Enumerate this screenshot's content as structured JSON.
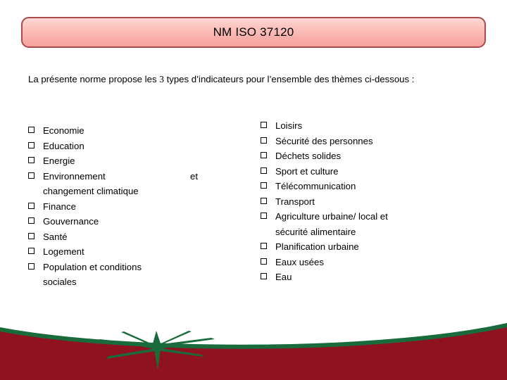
{
  "title": {
    "text": "NM ISO 37120"
  },
  "intro": {
    "part1": "La présente norme propose les ",
    "count": "3",
    "part2": " types d’indicateurs pour l’ensemble des thèmes ci-dessous :"
  },
  "bullet_symbol": "q",
  "columns": {
    "left": [
      {
        "label": "Economie"
      },
      {
        "label": "Education"
      },
      {
        "label": "Energie"
      },
      {
        "label": "Environnement",
        "trailing": "et",
        "continuation": "changement climatique"
      },
      {
        "label": "Finance"
      },
      {
        "label": "Gouvernance"
      },
      {
        "label": "Santé"
      },
      {
        "label": "Logement"
      },
      {
        "label": "Population et conditions",
        "continuation": "sociales"
      }
    ],
    "right": [
      {
        "label": "Loisirs"
      },
      {
        "label": "Sécurité des personnes"
      },
      {
        "label": "Déchets solides"
      },
      {
        "label": "Sport et culture"
      },
      {
        "label": "Télécommunication"
      },
      {
        "label": "Transport"
      },
      {
        "label": "Agriculture urbaine/ local et",
        "continuation": "sécurité alimentaire"
      },
      {
        "label": "Planification urbaine"
      },
      {
        "label": "Eaux usées"
      },
      {
        "label": "Eau"
      }
    ]
  },
  "colors": {
    "banner_border": "#a84a4a",
    "banner_fill_top": "#fdd8d4",
    "banner_fill_bottom": "#f5a39c",
    "band_red": "#8e1220",
    "band_green": "#1a6b3c",
    "text": "#000000"
  }
}
